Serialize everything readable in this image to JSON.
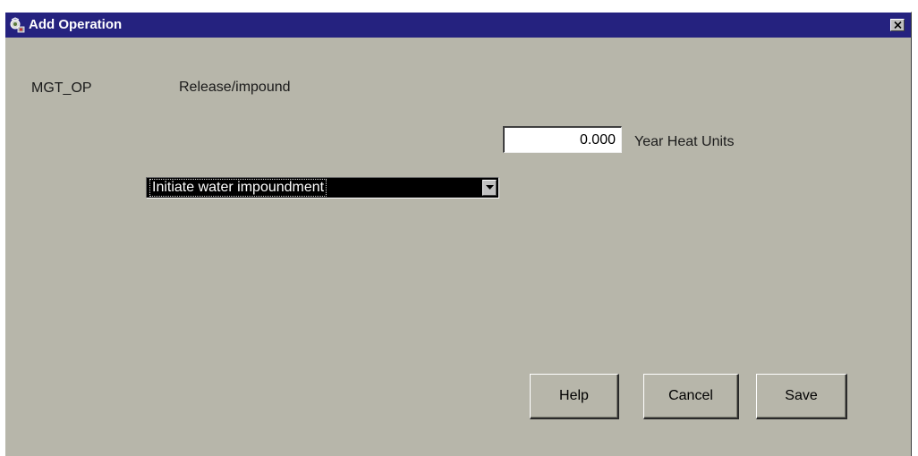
{
  "window": {
    "title": "Add Operation",
    "icon": "operation-app-icon",
    "close_icon": "close-icon",
    "colors": {
      "titlebar": "#25227f",
      "background": "#b7b6aa"
    }
  },
  "form": {
    "operation_code_label": "MGT_OP",
    "operation_name": "Release/impound",
    "heat_units": {
      "value": "0.000",
      "label": "Year Heat Units"
    },
    "impound_select": {
      "selected": "Initiate water impoundment",
      "arrow_icon": "chevron-down-icon"
    }
  },
  "buttons": {
    "help": "Help",
    "cancel": "Cancel",
    "save": "Save"
  }
}
